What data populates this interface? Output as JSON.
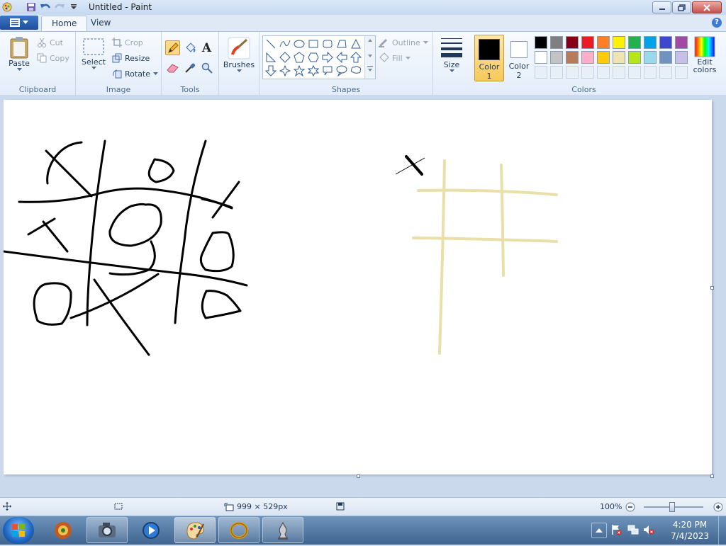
{
  "window": {
    "title": "Untitled - Paint"
  },
  "tabs": [
    {
      "label": "Home"
    },
    {
      "label": "View"
    }
  ],
  "ribbon": {
    "clipboard": {
      "label": "Clipboard",
      "paste": "Paste",
      "cut": "Cut",
      "copy": "Copy"
    },
    "image": {
      "label": "Image",
      "select": "Select",
      "crop": "Crop",
      "resize": "Resize",
      "rotate": "Rotate"
    },
    "tools": {
      "label": "Tools",
      "text_glyph": "A"
    },
    "brushes": {
      "label": "Brushes"
    },
    "shapes": {
      "label": "Shapes",
      "outline": "Outline",
      "fill": "Fill"
    },
    "size": {
      "label": "Size"
    },
    "color1": {
      "label": "Color",
      "sub": "1",
      "value": "#000000"
    },
    "color2": {
      "label": "Color",
      "sub": "2",
      "value": "#ffffff"
    },
    "colors": {
      "label": "Colors",
      "edit": "Edit",
      "edit2": "colors"
    },
    "palette_row1": [
      "#000000",
      "#7f7f7f",
      "#880015",
      "#ed1c24",
      "#ff7f27",
      "#fff200",
      "#22b14c",
      "#00a2e8",
      "#3f48cc",
      "#a349a4"
    ],
    "palette_row2": [
      "#ffffff",
      "#c3c3c3",
      "#b97a57",
      "#ffaec9",
      "#ffc90e",
      "#efe4b0",
      "#b5e61d",
      "#99d9ea",
      "#7092be",
      "#c8bfe7"
    ]
  },
  "status": {
    "canvas_size": "999 × 529px",
    "zoom": "100%"
  },
  "taskbar": {
    "time": "4:20 PM",
    "date": "7/4/2023"
  },
  "help_glyph": "?"
}
